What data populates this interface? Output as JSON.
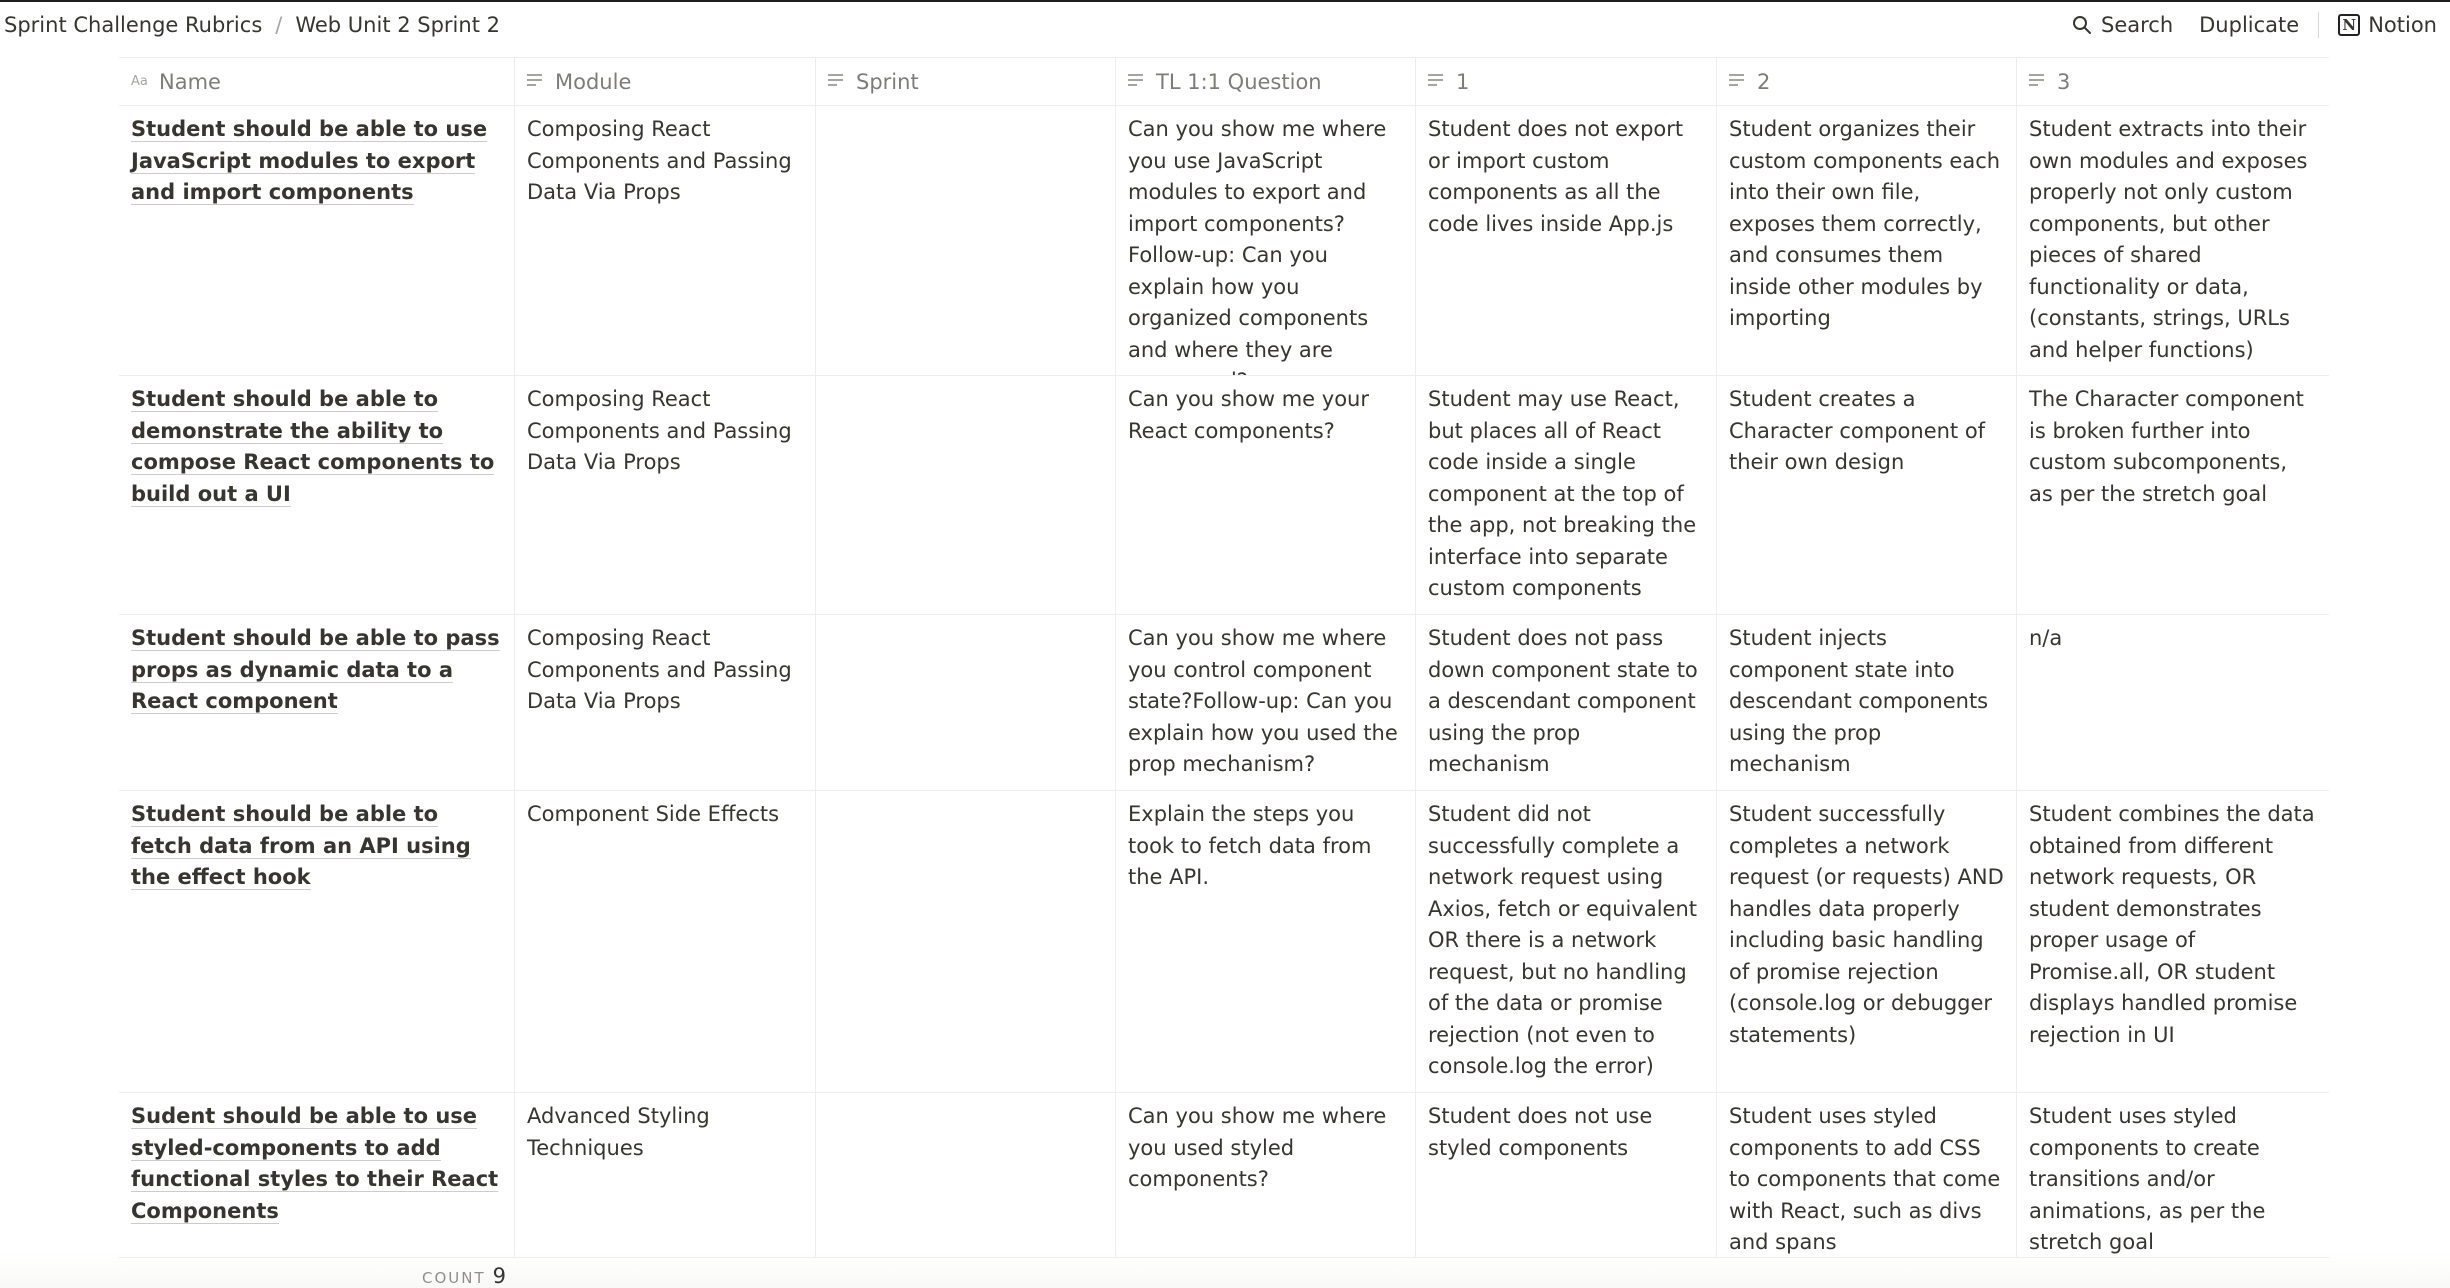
{
  "breadcrumb": {
    "items": [
      "Sprint Challenge Rubrics",
      "Web Unit 2 Sprint 2"
    ],
    "separator": "/"
  },
  "actions": {
    "search": "Search",
    "duplicate": "Duplicate",
    "notion": "Notion",
    "notion_logo": "N"
  },
  "columns": [
    {
      "label": "Name",
      "icon": "title-icon"
    },
    {
      "label": "Module",
      "icon": "text-property-icon"
    },
    {
      "label": "Sprint",
      "icon": "text-property-icon"
    },
    {
      "label": "TL 1:1 Question",
      "icon": "text-property-icon"
    },
    {
      "label": "1",
      "icon": "text-property-icon"
    },
    {
      "label": "2",
      "icon": "text-property-icon"
    },
    {
      "label": "3",
      "icon": "text-property-icon"
    }
  ],
  "rows": [
    {
      "name": "Student should be able to use JavaScript modules to export and import components",
      "module": "Composing React Components and Passing Data Via Props",
      "sprint": "",
      "question": "Can you show me where you use JavaScript modules to export and import components? Follow-up: Can you explain how you organized components and where they are consumed?",
      "r1": "Student does not export or import custom components as all the code lives inside App.js",
      "r2": "Student organizes their custom components each into their own file, exposes them correctly, and consumes them inside other modules by importing",
      "r3": "Student extracts into their own modules and exposes properly not only custom components, but other pieces of shared functionality or data, (constants, strings, URLs and helper functions)"
    },
    {
      "name": "Student should be able to demonstrate the ability to compose React components to build out a UI",
      "module": "Composing React Components and Passing Data Via Props",
      "sprint": "",
      "question": "Can you show me your React components?",
      "r1": "Student may use React, but places all of React code inside a single component at the top of the app, not breaking the interface into separate custom components",
      "r2": "Student creates a Character component of their own design",
      "r3": "The Character component is broken further into custom subcomponents, as per the stretch goal"
    },
    {
      "name": "Student should be able to pass props as dynamic data to a React component",
      "module": "Composing React Components and Passing Data Via Props",
      "sprint": "",
      "question": "Can you show me where you control component state?Follow-up: Can you explain how you used the prop mechanism?",
      "r1": "Student does not pass down component state to a descendant component using the prop mechanism",
      "r2": "Student injects component state into descendant components using the prop mechanism",
      "r3": "n/a"
    },
    {
      "name": "Student should be able to fetch data from an API using the effect hook",
      "module": "Component Side Effects",
      "sprint": "",
      "question": "Explain the steps you took to fetch data from the API.",
      "r1": "Student did not successfully complete a network request using Axios, fetch or equivalent OR there is a network request, but no handling of the data or promise rejection (not even to console.log the error)",
      "r2": "Student successfully completes a network request (or requests) AND handles data properly including basic handling of promise rejection (console.log or debugger statements)",
      "r3": "Student combines the data obtained from different network requests, OR student demonstrates proper usage of Promise.all, OR student displays handled promise rejection in UI"
    },
    {
      "name": "Sudent should be able to use styled-components to add functional styles to their React Components",
      "module": "Advanced Styling Techniques",
      "sprint": "",
      "question": "Can you show me where you used styled components?",
      "r1": "Student does not use styled components",
      "r2": "Student uses styled components to add CSS to components that come with React, such as divs and spans",
      "r3": "Student uses styled components to create transitions and/or animations, as per the stretch goal"
    }
  ],
  "footer": {
    "count_label": "COUNT",
    "count_value": "9"
  }
}
